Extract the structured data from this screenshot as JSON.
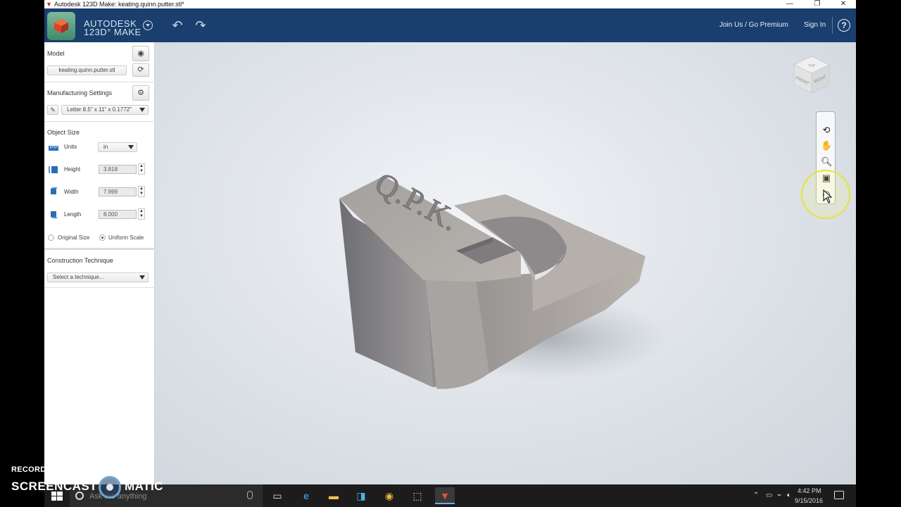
{
  "window": {
    "title": "Autodesk 123D Make: keating.quinn.putter.stl*",
    "minimize": "—",
    "restore": "❐",
    "close": "✕"
  },
  "header": {
    "brand_line1": "AUTODESK",
    "brand_line2": "123D° MAKE",
    "undo_icon": "undo-icon",
    "redo_icon": "redo-icon",
    "join_link": "Join Us / Go Premium",
    "sign_in": "Sign In",
    "help": "?"
  },
  "panel": {
    "model": {
      "label": "Model",
      "file": "keating.quinn.putter.stl"
    },
    "manufacturing": {
      "label": "Manufacturing Settings",
      "sheet": "Letter 8.5\" x 11\" x 0.1772\""
    },
    "object_size": {
      "label": "Object Size",
      "units_label": "Units",
      "units_value": "in",
      "height_label": "Height",
      "height_value": "3.818",
      "width_label": "Width",
      "width_value": "7.999",
      "length_label": "Length",
      "length_value": "8.000",
      "original_size": "Original Size",
      "uniform_scale": "Uniform Scale",
      "selected_scale_option": "Uniform Scale"
    },
    "construction": {
      "label": "Construction Technique",
      "placeholder": "Select a technique..."
    }
  },
  "viewport": {
    "engraving": "Q.P.K.",
    "navcube_faces": [
      "TOP",
      "FRONT",
      "RIGHT"
    ],
    "nav_tools": [
      "orbit-icon",
      "pan-icon",
      "zoom-icon",
      "fit-view-icon",
      "look-at-icon"
    ]
  },
  "taskbar": {
    "search_placeholder": "Ask me anything",
    "time": "4:42 PM",
    "date": "9/15/2016",
    "apps": [
      "task-view-icon",
      "edge-icon",
      "file-explorer-icon",
      "store-icon",
      "chrome-icon",
      "snipping-tool-icon",
      "123d-make-icon"
    ]
  },
  "watermark": {
    "line1": "RECORDED WITH",
    "line2a": "SCREENCAST",
    "line2b": "MATIC"
  }
}
